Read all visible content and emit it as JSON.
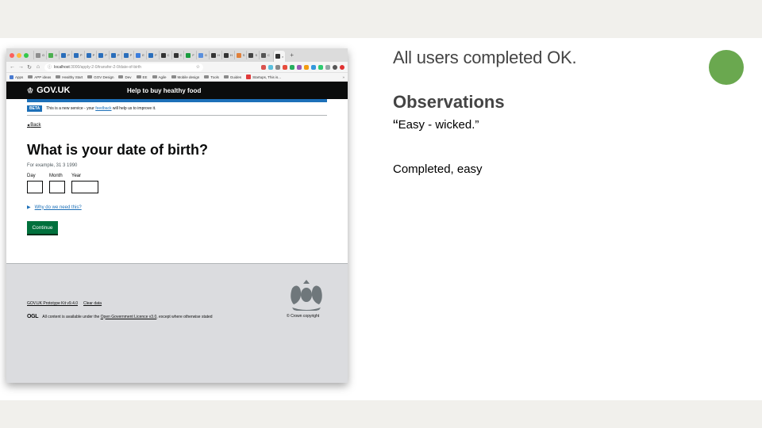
{
  "colors": {
    "accent_dot": "#6aa84f",
    "gov_black": "#0b0c0c",
    "gov_blue": "#1d70b8",
    "gov_green": "#00703c",
    "footer_grey": "#dbdcdf"
  },
  "browser": {
    "tabs": [
      "G",
      "G",
      "P",
      "P",
      "P",
      "P",
      "P",
      "P",
      "E",
      "P",
      "C",
      "C",
      "F",
      "G",
      "H",
      "H",
      "S",
      "S",
      "C"
    ],
    "active_tab_close": "×",
    "new_tab": "+",
    "address_host": "localhost",
    "address_path": ":3000/apply-2-0/transfer-2-0/date-of-birth",
    "bookmarks": [
      "Apps",
      "APP ideas",
      "Healthy Start",
      "GOV Design",
      "Dev",
      "EE",
      "Agile",
      "Mobile design",
      "Tools",
      "Guides",
      "Startups, This is..."
    ],
    "bookmarks_more": "»"
  },
  "page": {
    "logo_text": "GOV.UK",
    "service_name": "Help to buy healthy food",
    "beta_tag": "BETA",
    "beta_text_before": "This is a new service - your",
    "beta_link": "feedback",
    "beta_text_after": "will help us to improve it.",
    "back_link": "Back",
    "question": "What is your date of birth?",
    "hint": "For example, 31 3 1990",
    "labels": {
      "day": "Day",
      "month": "Month",
      "year": "Year"
    },
    "details_summary": "Why do we need this?",
    "continue_button": "Continue"
  },
  "footer": {
    "links": [
      "GOV.UK Prototype Kit v9.4.0",
      "Clear data"
    ],
    "ogl_logo": "OGL",
    "licence_before": "All content is available under the",
    "licence_link": "Open Government Licence v3.0",
    "licence_after": ", except where otherwise stated",
    "copyright": "© Crown copyright"
  },
  "slide": {
    "status": "All users completed OK.",
    "observations_heading": "Observations",
    "quote_open": "“",
    "quote_text": "Easy - wicked.”",
    "note": "Completed, easy"
  }
}
